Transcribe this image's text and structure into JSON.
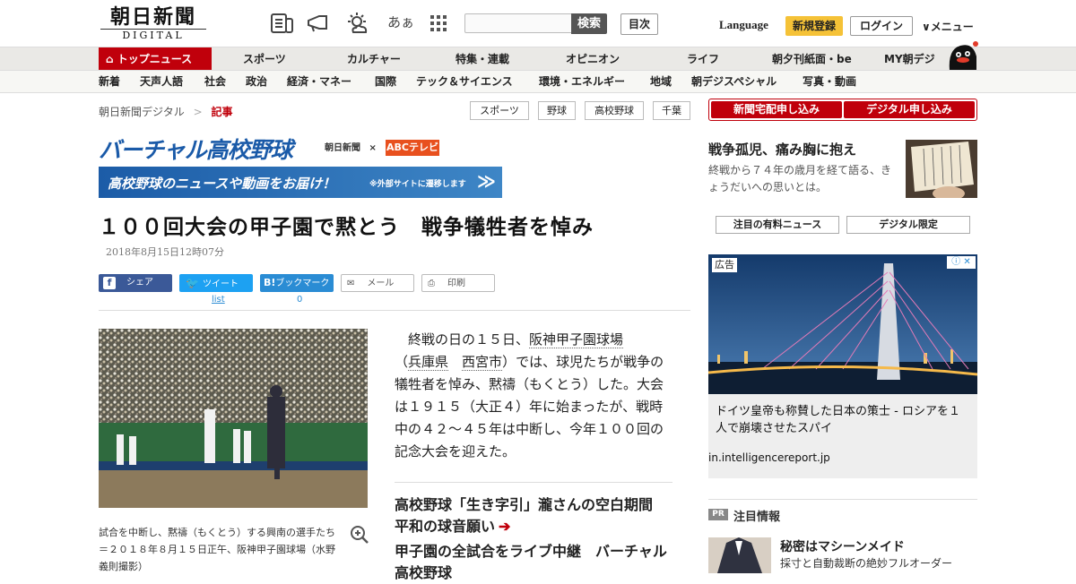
{
  "header": {
    "logo_jp": "朝日新聞",
    "logo_en": "DIGITAL",
    "icons": [
      "newspaper-icon",
      "megaphone-icon",
      "weather-icon",
      "font-size-icon",
      "grid-icon"
    ],
    "font_icon_text": "あぁ",
    "search_placeholder": "",
    "search_button": "検索",
    "mokuji": "目次",
    "language": "Language",
    "register": "新規登録",
    "login": "ログイン",
    "menu": "メニュー"
  },
  "nav1": {
    "home": "トップニュース",
    "items": [
      "スポーツ",
      "カルチャー",
      "特集・連載",
      "オピニオン",
      "ライフ",
      "朝夕刊紙面・be",
      "MY朝デジ"
    ]
  },
  "nav2": {
    "items": [
      "新着",
      "天声人語",
      "社会",
      "政治",
      "経済・マネー",
      "国際",
      "テック＆サイエンス",
      "環境・エネルギー",
      "地域",
      "朝デジスペシャル",
      "写真・動画"
    ]
  },
  "breadcrumb": {
    "home": "朝日新聞デジタル",
    "sep": ">",
    "current": "記事"
  },
  "tags": [
    "スポーツ",
    "野球",
    "高校野球",
    "千葉"
  ],
  "virtual": {
    "title": "バーチャル高校野球",
    "partner_asahi": "朝日新聞",
    "partner_times": "×",
    "partner_abc": "ABCテレビ",
    "bar_text": "高校野球のニュースや動画をお届け！",
    "bar_note": "※外部サイトに遷移します",
    "bar_arrow": "≫"
  },
  "article": {
    "headline": "１００回大会の甲子園で黙とう　戦争犠牲者を悼み",
    "date": "2018年8月15日12時07分",
    "share": {
      "facebook": "シェア",
      "twitter": "ツイート",
      "twitter_count": "list",
      "hatena": "ブックマーク",
      "hatena_count": "0",
      "mail": "メール",
      "print": "印刷"
    },
    "caption": "試合を中断し、黙禱（もくとう）する興南の選手たち＝２０１８年８月１５日正午、阪神甲子園球場（水野義則撮影）",
    "body_intro": "　終戦の日の１５日、",
    "link1": "阪神甲子園球場",
    "body_paren_open": "（",
    "link2": "兵庫県",
    "body_space": "　",
    "link3": "西宮市",
    "body_rest": "）では、球児たちが戦争の犠牲者を悼み、黙禱（もくとう）した。大会は１９１５（大正４）年に始まったが、戦時中の４２～４５年は中断し、今年１００回の記念大会を迎えた。",
    "related": [
      "高校野球「生き字引」瀧さんの空白期間　平和の球音願い",
      "甲子園の全試合をライブ中継　バーチャル高校野球"
    ]
  },
  "sidebar": {
    "subscribe": [
      "新聞宅配申し込み",
      "デジタル申し込み"
    ],
    "feature_title": "戦争孤児、痛み胸に抱え",
    "feature_text": "終戦から７４年の歳月を経て語る、きょうだいへの思いとは。",
    "premium_tabs": [
      "注目の有料ニュース",
      "デジタル限定"
    ],
    "ad": {
      "label": "広告",
      "text": "ドイツ皇帝も称賛した日本の策士 - ロシアを１人で崩壊させたスパイ",
      "url": "in.intelligencereport.jp"
    },
    "pr": {
      "badge": "PR",
      "title": "注目情報",
      "headline": "秘密はマシーンメイド",
      "sub": "採寸と自動裁断の絶妙フルオーダー"
    }
  },
  "colors": {
    "brand_red": "#c0000b",
    "register_yellow": "#f5c237",
    "virtual_blue": "#1c5ca7"
  }
}
